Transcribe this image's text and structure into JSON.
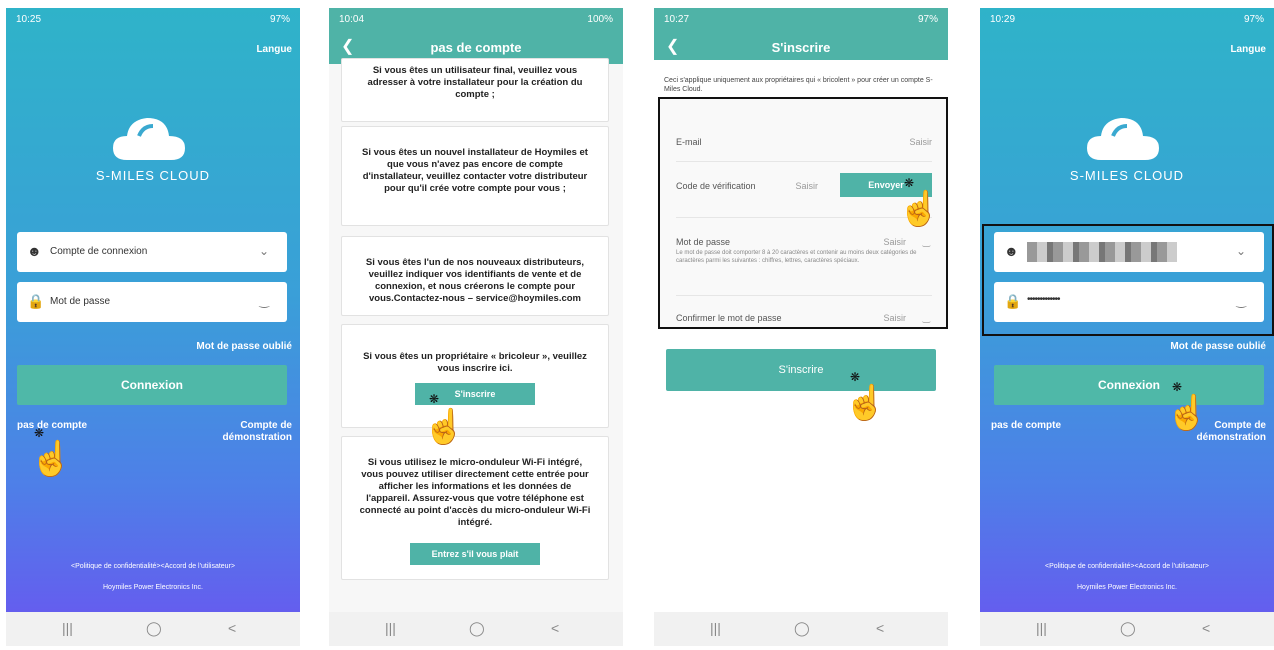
{
  "screens": [
    {
      "time": "10:25",
      "status_right": "97%",
      "language": "Langue",
      "brand": "S-MILES CLOUD",
      "account_placeholder": "Compte de connexion",
      "password_placeholder": "Mot de passe",
      "forgot": "Mot de passe oublié",
      "login": "Connexion",
      "no_account": "pas de compte",
      "demo_line1": "Compte de",
      "demo_line2": "démonstration",
      "policy": "<Politique de confidentialité><Accord de l'utilisateur>",
      "company": "Hoymiles Power Electronics Inc."
    },
    {
      "time": "10:04",
      "status_right": "100%",
      "title": "pas de compte",
      "card1": "Si vous êtes un utilisateur final, veuillez vous adresser à votre installateur pour la création du compte ;",
      "card2": "Si vous êtes un nouvel installateur de Hoymiles et que vous n'avez pas encore de compte d'installateur, veuillez contacter votre distributeur pour qu'il crée votre compte pour vous ;",
      "card3": "Si vous êtes l'un de nos nouveaux distributeurs, veuillez indiquer vos identifiants de vente et de connexion, et nous créerons le compte pour vous.Contactez-nous – service@hoymiles.com",
      "card4": "Si vous êtes un propriétaire « bricoleur », veuillez vous inscrire ici.",
      "card4_button": "S'inscrire",
      "card5": "Si vous utilisez le micro-onduleur Wi-Fi intégré, vous pouvez utiliser directement cette entrée pour afficher les informations et les données de l'appareil. Assurez-vous que votre téléphone est connecté au point d'accès du micro-onduleur Wi-Fi intégré.",
      "card5_button": "Entrez s'il vous plait"
    },
    {
      "time": "10:27",
      "status_right": "97%",
      "title": "S'inscrire",
      "note": "Ceci s'applique uniquement aux propriétaires qui « bricolent » pour créer un compte S-Miles Cloud.",
      "email_label": "E-mail",
      "enter": "Saisir",
      "code_label": "Code de vérification",
      "send": "Envoyer",
      "password_label": "Mot de passe",
      "password_hint": "Le mot de passe doit comporter 8 à 20 caractères et contenir au moins deux catégories de caractères parmi les suivantes : chiffres, lettres, caractères spéciaux.",
      "confirm_label": "Confirmer le mot de passe",
      "register_button": "S'inscrire"
    },
    {
      "time": "10:29",
      "status_right": "97%",
      "language": "Langue",
      "brand": "S-MILES CLOUD",
      "password_mask": "•••••••••••••",
      "forgot": "Mot de passe oublié",
      "login": "Connexion",
      "no_account": "pas de compte",
      "demo_line1": "Compte de",
      "demo_line2": "démonstration",
      "policy": "<Politique de confidentialité><Accord de l'utilisateur>",
      "company": "Hoymiles Power Electronics Inc."
    }
  ],
  "colors": {
    "teal": "#4fb3a7",
    "gradient_top": "#2fb3c9",
    "gradient_bottom": "#6a55f0"
  },
  "icons": [
    "user-icon",
    "lock-icon",
    "chevron-down-icon",
    "eye-closed-icon",
    "cloud-icon",
    "back-icon",
    "pointer-hand-icon"
  ]
}
